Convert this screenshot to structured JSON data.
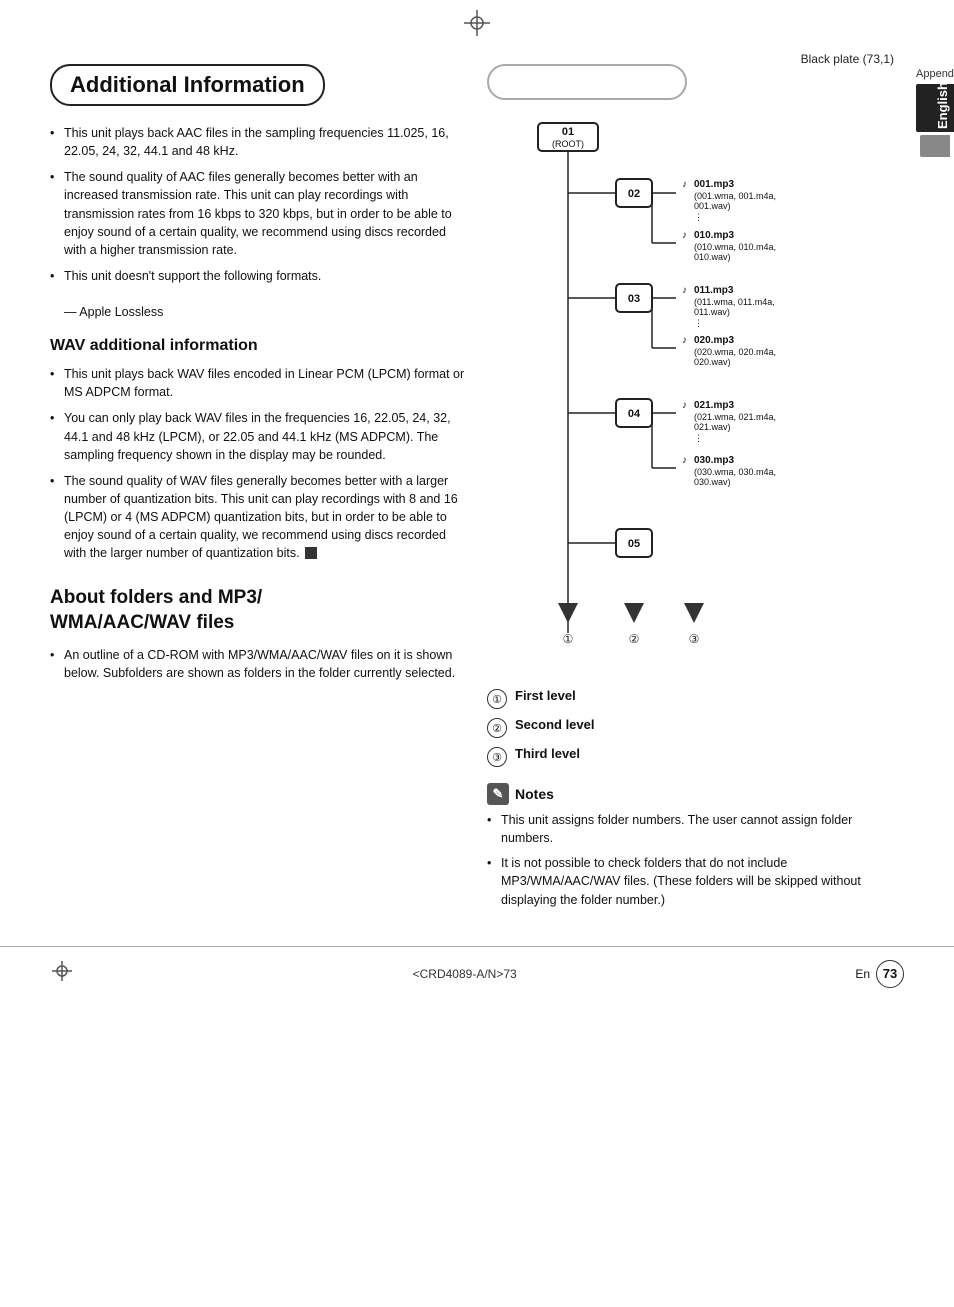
{
  "header": {
    "title": "Black plate (73,1)",
    "appendix_label": "Appendix",
    "english_label": "English"
  },
  "page": {
    "number": "73",
    "en_label": "En",
    "bottom_code": "<CRD4089-A/N>73"
  },
  "main_title": "Additional Information",
  "sections": {
    "aac_bullets": [
      "This unit plays back AAC files in the sampling frequencies 11.025, 16, 22.05, 24, 32, 44.1 and 48 kHz.",
      "The sound quality of AAC files generally becomes better with an increased transmission rate. This unit can play recordings with transmission rates from 16 kbps to 320 kbps, but in order to be able to enjoy sound of a certain quality, we recommend using discs recorded with a higher transmission rate.",
      "This unit doesn't support the following formats."
    ],
    "aac_sub": "— Apple Lossless",
    "wav_heading": "WAV additional information",
    "wav_bullets": [
      "This unit plays back WAV files encoded in Linear PCM (LPCM) format or MS ADPCM format.",
      "You can only play back WAV files in the frequencies 16, 22.05, 24, 32, 44.1 and 48 kHz (LPCM), or 22.05 and 44.1 kHz (MS ADPCM). The sampling frequency shown in the display may be rounded.",
      "The sound quality of WAV files generally becomes better with a larger number of quantization bits. This unit can play recordings with 8 and 16 (LPCM) or 4 (MS ADPCM) quantization bits, but in order to be able to enjoy sound of a certain quality, we recommend using discs recorded with the larger number of quantization bits."
    ],
    "folders_heading": "About folders and MP3/\nWMA/AAC/WAV files",
    "folders_bullets": [
      "An outline of a CD-ROM with MP3/WMA/AAC/WAV files on it is shown below. Subfolders are shown as folders in the folder currently selected."
    ]
  },
  "diagram": {
    "folders": [
      {
        "id": "01",
        "label": "01\n(ROOT)"
      },
      {
        "id": "02",
        "label": "02"
      },
      {
        "id": "03",
        "label": "03"
      },
      {
        "id": "04",
        "label": "04"
      },
      {
        "id": "05",
        "label": "05"
      }
    ],
    "files": [
      {
        "name": "001.mp3",
        "sub": "(001.wma, 001.m4a,\n001.wav)"
      },
      {
        "name": "010.mp3",
        "sub": "(010.wma, 010.m4a,\n010.wav)"
      },
      {
        "name": "011.mp3",
        "sub": "(011.wma, 011.m4a,\n011.wav)"
      },
      {
        "name": "020.mp3",
        "sub": "(020.wma, 020.m4a,\n020.wav)"
      },
      {
        "name": "021.mp3",
        "sub": "(021.wma, 021.m4a,\n021.wav)"
      },
      {
        "name": "030.mp3",
        "sub": "(030.wma, 030.m4a,\n030.wav)"
      }
    ],
    "levels": [
      {
        "num": "①",
        "label": "First level"
      },
      {
        "num": "②",
        "label": "Second level"
      },
      {
        "num": "③",
        "label": "Third level"
      }
    ]
  },
  "notes": {
    "heading": "Notes",
    "items": [
      "This unit assigns folder numbers. The user cannot assign folder numbers.",
      "It is not possible to check folders that do not include MP3/WMA/AAC/WAV files. (These folders will be skipped without displaying the folder number.)"
    ]
  }
}
